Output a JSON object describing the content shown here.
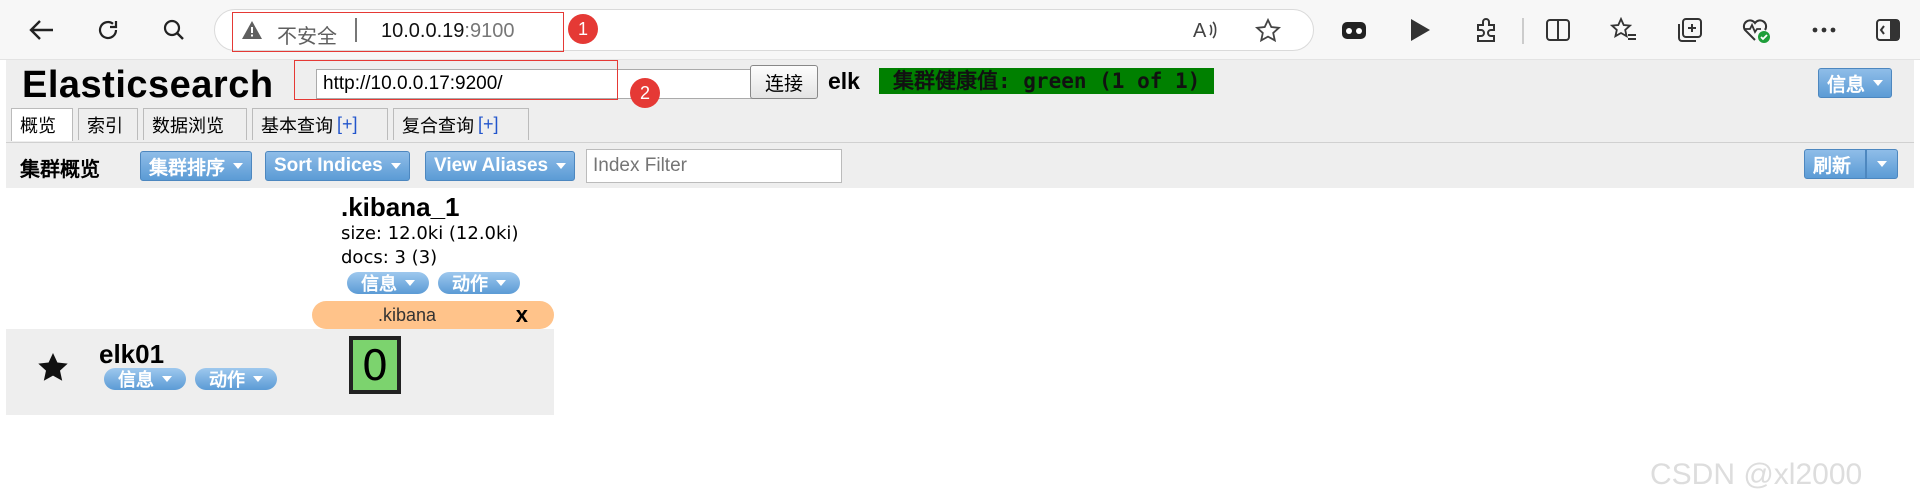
{
  "browser": {
    "insecure_label": "不安全",
    "host": "10.0.0.19",
    "port": ":9100",
    "annotation_1": "1",
    "annotation_2": "2"
  },
  "header": {
    "title": "Elasticsearch",
    "url_value": "http://10.0.0.17:9200/",
    "connect_label": "连接",
    "cluster_name": "elk",
    "health": "集群健康值: green (1 of 1)",
    "health_color": "#008000",
    "info_label": "信息"
  },
  "tabs": [
    {
      "label": "概览"
    },
    {
      "label": "索引"
    },
    {
      "label": "数据浏览"
    },
    {
      "label": "基本查询",
      "plus": "[+]"
    },
    {
      "label": "复合查询",
      "plus": "[+]"
    }
  ],
  "toolbar": {
    "title": "集群概览",
    "sort_cluster": "集群排序",
    "sort_indices": "Sort Indices",
    "view_aliases": "View Aliases",
    "filter_placeholder": "Index Filter",
    "refresh_label": "刷新"
  },
  "index": {
    "name": ".kibana_1",
    "size": "size: 12.0ki (12.0ki)",
    "docs": "docs: 3 (3)",
    "info_label": "信息",
    "action_label": "动作",
    "alias": ".kibana",
    "alias_close": "x"
  },
  "node": {
    "name": "elk01",
    "info_label": "信息",
    "action_label": "动作",
    "shard": "0",
    "shard_color": "#7cd36e"
  },
  "watermark": "CSDN @xl2000"
}
